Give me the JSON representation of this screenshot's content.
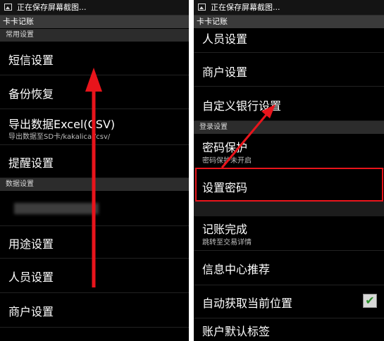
{
  "status_text": "正在保存屏幕截图...",
  "app_title": "卡卡记账",
  "left": {
    "section_common": "常用设置",
    "sms_settings": "短信设置",
    "backup_restore": "备份恢复",
    "export_excel": "导出数据Excel(CSV)",
    "export_excel_sub": "导出数据至SD卡/kakalicai/csv/",
    "reminder_settings": "提醒设置",
    "section_data": "数据设置",
    "purpose_settings": "用途设置",
    "member_settings": "人员设置",
    "merchant_settings": "商户设置"
  },
  "right": {
    "member_settings": "人员设置",
    "merchant_settings": "商户设置",
    "custom_bank_settings": "自定义银行设置",
    "section_login": "登录设置",
    "password_protect": "密码保护",
    "password_protect_sub": "密码保护未开启",
    "set_password": "设置密码",
    "record_complete": "记账完成",
    "record_complete_sub": "跳转至交易详情",
    "info_center": "信息中心推荐",
    "auto_location": "自动获取当前位置",
    "auto_location_checked": true,
    "account_default_tag": "账户默认标签"
  },
  "colors": {
    "arrow_red": "#e8141b",
    "highlight_red": "#e8141b",
    "check_green": "#2a8f2a"
  }
}
